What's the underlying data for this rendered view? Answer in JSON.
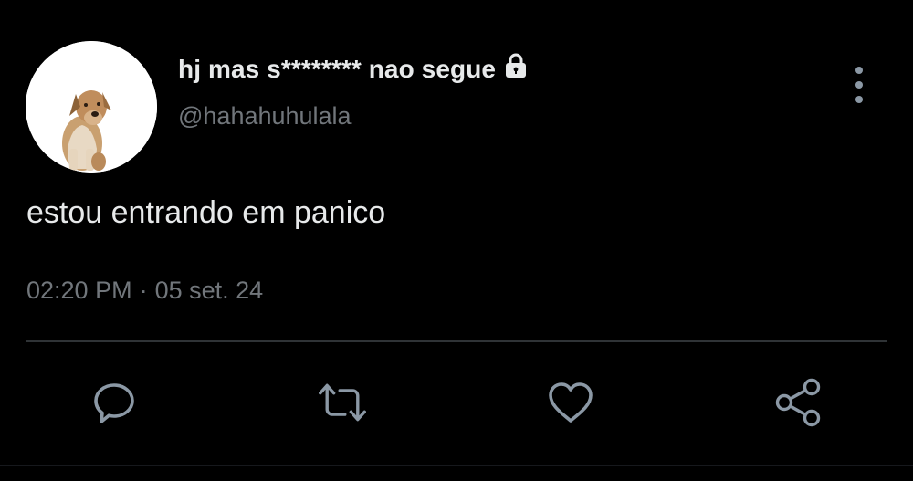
{
  "tweet": {
    "display_name": "hj mas s******** nao segue",
    "handle": "@hahahuhulala",
    "text": "estou entrando em panico",
    "time": "02:20 PM",
    "separator": "·",
    "date": "05 set. 24"
  },
  "icons": {
    "lock": "lock-icon",
    "more": "more-vertical-icon",
    "reply": "reply-icon",
    "retweet": "retweet-icon",
    "like": "heart-icon",
    "share": "share-icon"
  },
  "colors": {
    "background": "#000000",
    "primary_text": "#e7e9ea",
    "secondary_text": "#71767b",
    "icon": "#8b98a5",
    "divider": "#2f3336"
  }
}
